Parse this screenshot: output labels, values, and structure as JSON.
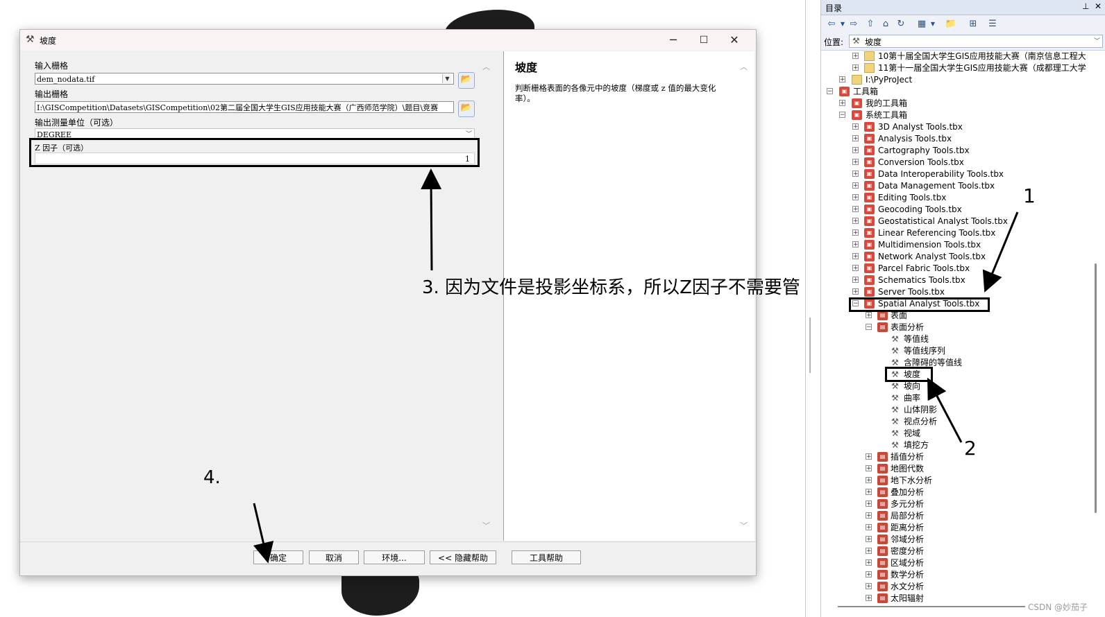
{
  "dialog": {
    "title": "坡度",
    "window_controls": {
      "minimize": "─",
      "maximize": "☐",
      "close": "✕"
    },
    "fields": {
      "input_raster_label": "输入栅格",
      "input_raster_value": "dem_nodata.tif",
      "output_raster_label": "输出栅格",
      "output_raster_value": "I:\\GISCompetition\\Datasets\\GISCompetition\\02第二届全国大学生GIS应用技能大赛（广西师范学院）\\题目\\竞赛",
      "measurement_label": "输出测量单位（可选）",
      "measurement_value": "DEGREE",
      "zfactor_label": "Z 因子（可选）",
      "zfactor_value": "1"
    },
    "help": {
      "title": "坡度",
      "body": "判断栅格表面的各像元中的坡度（梯度或 z 值的最大变化率）。"
    },
    "buttons": {
      "ok": "确定",
      "cancel": "取消",
      "env": "环境...",
      "hide_help": "<< 隐藏帮助",
      "tool_help": "工具帮助"
    }
  },
  "annotations": {
    "step1": "1",
    "step2": "2",
    "step3": "3. 因为文件是投影坐标系，所以Z因子不需要管",
    "step4": "4."
  },
  "catalog": {
    "title": "目录",
    "pin": "⊥",
    "close": "✕",
    "location_label": "位置:",
    "location_value": "坡度",
    "tree": [
      {
        "label": "10第十届全国大学生GIS应用技能大赛（南京信息工程大"
      },
      {
        "label": "11第十一届全国大学生GIS应用技能大赛（成都理工大学"
      },
      {
        "label": "I:\\PyProJect"
      },
      {
        "label": "工具箱"
      },
      {
        "label": "我的工具箱"
      },
      {
        "label": "系统工具箱"
      },
      {
        "label": "3D Analyst Tools.tbx"
      },
      {
        "label": "Analysis Tools.tbx"
      },
      {
        "label": "Cartography Tools.tbx"
      },
      {
        "label": "Conversion Tools.tbx"
      },
      {
        "label": "Data Interoperability Tools.tbx"
      },
      {
        "label": "Data Management Tools.tbx"
      },
      {
        "label": "Editing Tools.tbx"
      },
      {
        "label": "Geocoding Tools.tbx"
      },
      {
        "label": "Geostatistical Analyst Tools.tbx"
      },
      {
        "label": "Linear Referencing Tools.tbx"
      },
      {
        "label": "Multidimension Tools.tbx"
      },
      {
        "label": "Network Analyst Tools.tbx"
      },
      {
        "label": "Parcel Fabric Tools.tbx"
      },
      {
        "label": "Schematics Tools.tbx"
      },
      {
        "label": "Server Tools.tbx"
      },
      {
        "label": "Spatial Analyst Tools.tbx"
      },
      {
        "label": "表面"
      },
      {
        "label": "表面分析"
      },
      {
        "label": "等值线"
      },
      {
        "label": "等值线序列"
      },
      {
        "label": "含障碍的等值线"
      },
      {
        "label": "坡度"
      },
      {
        "label": "坡向"
      },
      {
        "label": "曲率"
      },
      {
        "label": "山体阴影"
      },
      {
        "label": "视点分析"
      },
      {
        "label": "视域"
      },
      {
        "label": "填挖方"
      },
      {
        "label": "插值分析"
      },
      {
        "label": "地图代数"
      },
      {
        "label": "地下水分析"
      },
      {
        "label": "叠加分析"
      },
      {
        "label": "多元分析"
      },
      {
        "label": "局部分析"
      },
      {
        "label": "距离分析"
      },
      {
        "label": "邻域分析"
      },
      {
        "label": "密度分析"
      },
      {
        "label": "区域分析"
      },
      {
        "label": "数学分析"
      },
      {
        "label": "水文分析"
      },
      {
        "label": "太阳辐射"
      }
    ]
  },
  "watermark": "CSDN @妙茄子"
}
